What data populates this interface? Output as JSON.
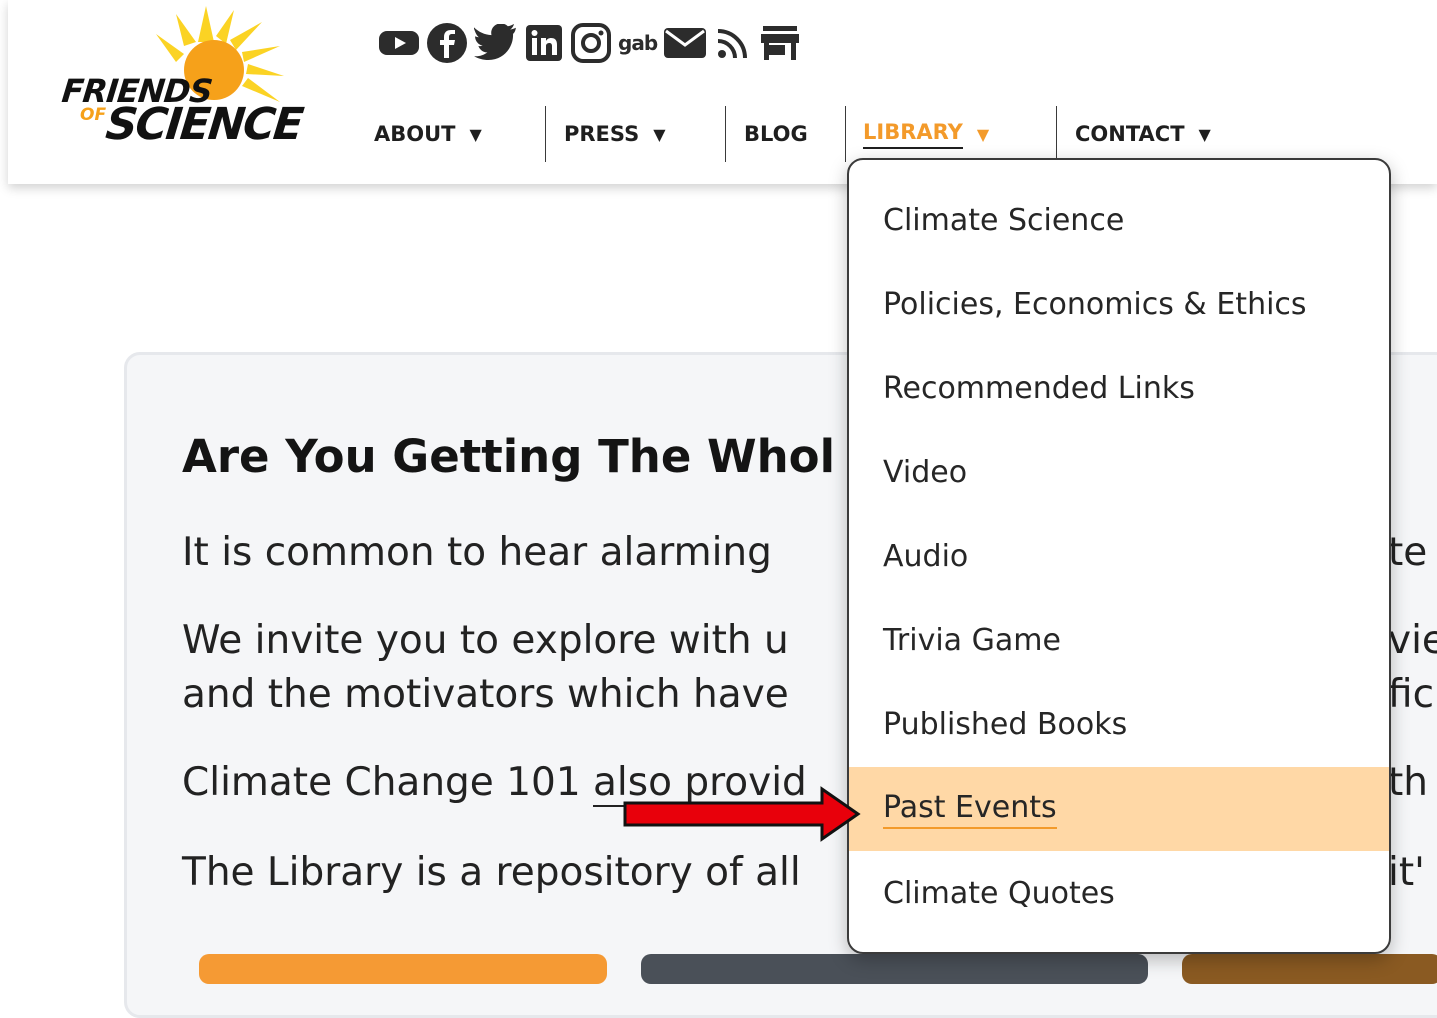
{
  "logo": {
    "line1": "FRIENDS",
    "line2": "OF",
    "line3": "SCIENCE"
  },
  "social_icons": [
    "youtube-icon",
    "facebook-icon",
    "twitter-icon",
    "linkedin-icon",
    "instagram-icon",
    "gab-icon",
    "mail-icon",
    "rss-icon",
    "store-icon"
  ],
  "social": {
    "gab_label": "gab"
  },
  "nav": {
    "about": "ABOUT",
    "press": "PRESS",
    "blog": "BLOG",
    "library": "LIBRARY",
    "contact": "CONTACT",
    "arrow": "▼"
  },
  "library_menu": [
    "Climate Science",
    "Policies, Economics & Ethics",
    "Recommended Links",
    "Video",
    "Audio",
    "Trivia Game",
    "Published Books",
    "Past Events",
    "Climate Quotes"
  ],
  "main": {
    "title": "Are You Getting The Whol",
    "p1": "It is common to hear alarming",
    "p1_right": "te",
    "p2a": "We invite you to explore with u",
    "p2a_right": "vie",
    "p2b": "and the motivators which have",
    "p2b_right": "fic",
    "p3_start": "Climate Change 101 ",
    "p3_link": "also provid",
    "p3_right": "th",
    "p4": "The Library is a repository of all",
    "p4_right": "it'"
  },
  "colors": {
    "accent": "#f39a2a",
    "highlight": "#ffd8a6",
    "arrow": "#e8000b"
  }
}
